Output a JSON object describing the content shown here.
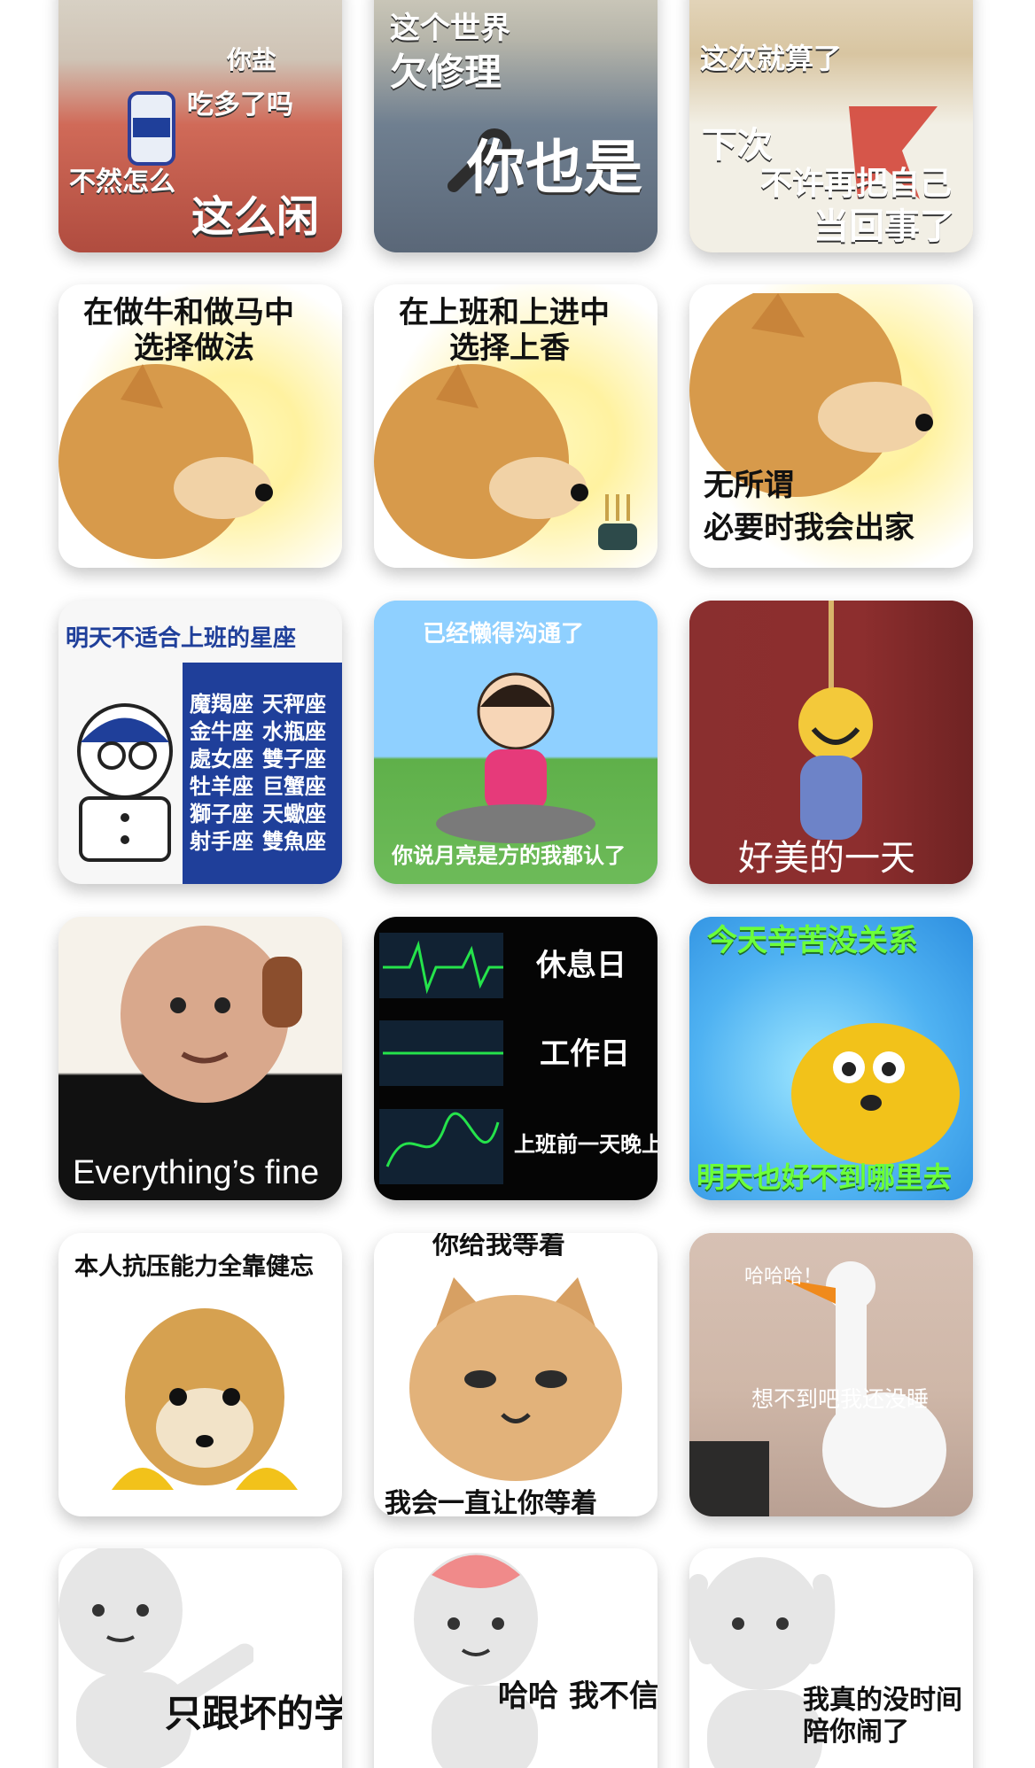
{
  "memes": [
    {
      "texts": [
        "你盐",
        "吃多了吗",
        "不然怎么",
        "这么闲"
      ],
      "colors": {
        "bg": "#c85a4a"
      }
    },
    {
      "texts": [
        "这个世界",
        "欠修理",
        "你也是"
      ],
      "colors": {
        "bg": "#9aa8b6"
      }
    },
    {
      "texts": [
        "这次就算了",
        "下次",
        "不许再把自己",
        "当回事了"
      ],
      "colors": {
        "bg": "#d7c7a6"
      }
    },
    {
      "texts": [
        "在做牛和做马中",
        "选择做法"
      ],
      "colors": {
        "bg": "#fff7d6"
      }
    },
    {
      "texts": [
        "在上班和上进中",
        "选择上香"
      ],
      "colors": {
        "bg": "#fff7d6"
      }
    },
    {
      "texts": [
        "无所谓",
        "必要时我会出家"
      ],
      "colors": {
        "bg": "#fff7d6"
      }
    },
    {
      "texts": [
        "明天不适合上班的星座",
        "魔羯座",
        "天秤座",
        "金牛座",
        "水瓶座",
        "處女座",
        "雙子座",
        "牡羊座",
        "巨蟹座",
        "獅子座",
        "天蠍座",
        "射手座",
        "雙魚座"
      ],
      "colors": {
        "bg": "#f7f7f7",
        "panel": "#1f3f9a"
      }
    },
    {
      "texts": [
        "已经懒得沟通了",
        "你说月亮是方的我都认了"
      ],
      "colors": {
        "bg": "#8fc9f0"
      }
    },
    {
      "texts": [
        "好美的一天"
      ],
      "colors": {
        "bg": "#8a2f2f"
      }
    },
    {
      "texts": [
        "Everything’s fine"
      ],
      "colors": {
        "bg": "#f3efe8"
      }
    },
    {
      "texts": [
        "休息日",
        "工作日",
        "上班前一天晚上"
      ],
      "colors": {
        "bg": "#050505",
        "trace": "#25e34b"
      }
    },
    {
      "texts": [
        "今天辛苦没关系",
        "明天也好不到哪里去"
      ],
      "colors": {
        "bg": "#4fb2f2",
        "text": "#6cff3a"
      }
    },
    {
      "texts": [
        "本人抗压能力全靠健忘"
      ],
      "colors": {
        "bg": "#ffffff"
      }
    },
    {
      "texts": [
        "你给我等着",
        "我会一直让你等着"
      ],
      "colors": {
        "bg": "#ffffff"
      }
    },
    {
      "texts": [
        "哈哈哈！",
        "想不到吧我还没睡"
      ],
      "colors": {
        "bg": "#cfb7a8"
      }
    },
    {
      "texts": [
        "只跟坏的学"
      ],
      "colors": {
        "bg": "#ffffff"
      }
    },
    {
      "texts": [
        "哈哈 我不信"
      ],
      "colors": {
        "bg": "#ffffff"
      }
    },
    {
      "texts": [
        "我真的没时间",
        "陪你闹了"
      ],
      "colors": {
        "bg": "#ffffff"
      }
    }
  ]
}
